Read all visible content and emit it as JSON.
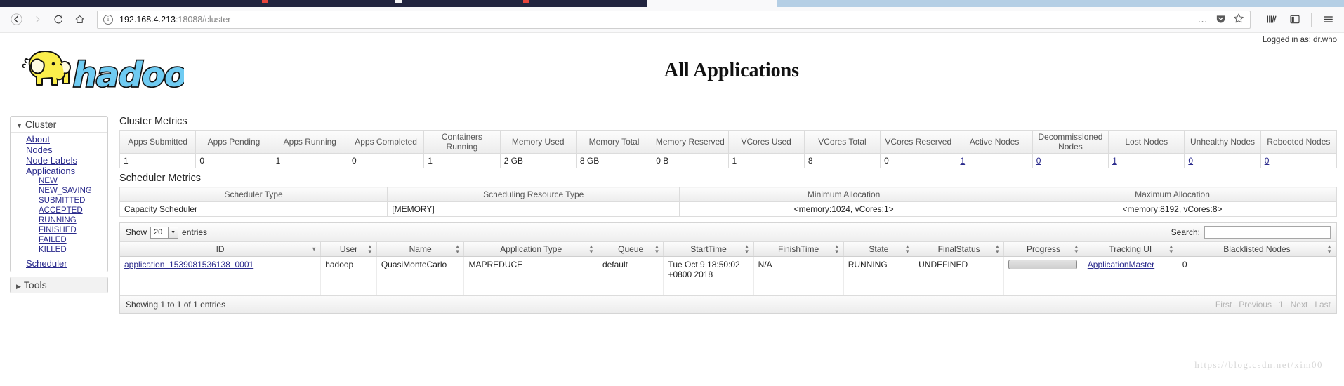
{
  "browser": {
    "back_icon": "back-arrow-icon",
    "forward_icon": "forward-arrow-icon",
    "reload_icon": "reload-icon",
    "home_icon": "home-icon",
    "url_host": "192.168.4.213",
    "url_rest": ":18088/cluster",
    "url_full": "192.168.4.213:18088/cluster",
    "page_actions_label": "…",
    "pocket_label": "▼",
    "star_label": "☆",
    "library_label": "|||\\",
    "sidebar_label": "▥",
    "menu_label": "☰"
  },
  "header": {
    "logged_in": "Logged in as: dr.who",
    "logo_text": "hadoop",
    "title": "All Applications"
  },
  "sidebar": {
    "cluster": {
      "label": "Cluster",
      "items": [
        {
          "label": "About"
        },
        {
          "label": "Nodes"
        },
        {
          "label": "Node Labels"
        },
        {
          "label": "Applications"
        }
      ],
      "app_states": [
        {
          "label": "NEW"
        },
        {
          "label": "NEW_SAVING"
        },
        {
          "label": "SUBMITTED"
        },
        {
          "label": "ACCEPTED"
        },
        {
          "label": "RUNNING"
        },
        {
          "label": "FINISHED"
        },
        {
          "label": "FAILED"
        },
        {
          "label": "KILLED"
        }
      ],
      "scheduler": {
        "label": "Scheduler"
      }
    },
    "tools": {
      "label": "Tools"
    }
  },
  "cluster_metrics": {
    "title": "Cluster Metrics",
    "columns": [
      "Apps Submitted",
      "Apps Pending",
      "Apps Running",
      "Apps Completed",
      "Containers Running",
      "Memory Used",
      "Memory Total",
      "Memory Reserved",
      "VCores Used",
      "VCores Total",
      "VCores Reserved",
      "Active Nodes",
      "Decommissioned Nodes",
      "Lost Nodes",
      "Unhealthy Nodes",
      "Rebooted Nodes"
    ],
    "values": [
      {
        "text": "1",
        "link": false
      },
      {
        "text": "0",
        "link": false
      },
      {
        "text": "1",
        "link": false
      },
      {
        "text": "0",
        "link": false
      },
      {
        "text": "1",
        "link": false
      },
      {
        "text": "2 GB",
        "link": false
      },
      {
        "text": "8 GB",
        "link": false
      },
      {
        "text": "0 B",
        "link": false
      },
      {
        "text": "1",
        "link": false
      },
      {
        "text": "8",
        "link": false
      },
      {
        "text": "0",
        "link": false
      },
      {
        "text": "1",
        "link": true
      },
      {
        "text": "0",
        "link": true
      },
      {
        "text": "1",
        "link": true
      },
      {
        "text": "0",
        "link": true
      },
      {
        "text": "0",
        "link": true
      }
    ]
  },
  "scheduler_metrics": {
    "title": "Scheduler Metrics",
    "columns": [
      "Scheduler Type",
      "Scheduling Resource Type",
      "Minimum Allocation",
      "Maximum Allocation"
    ],
    "row": {
      "scheduler_type": "Capacity Scheduler",
      "resource_type": "[MEMORY]",
      "min_allocation": "<memory:1024, vCores:1>",
      "max_allocation": "<memory:8192, vCores:8>"
    }
  },
  "apps_table": {
    "show_label": "Show",
    "entries_label": "entries",
    "page_size": "20",
    "search_label": "Search:",
    "search_value": "",
    "search_placeholder": "",
    "columns": [
      "ID",
      "User",
      "Name",
      "Application Type",
      "Queue",
      "StartTime",
      "FinishTime",
      "State",
      "FinalStatus",
      "Progress",
      "Tracking UI",
      "Blacklisted Nodes"
    ],
    "rows": [
      {
        "id": "application_1539081536138_0001",
        "user": "hadoop",
        "name": "QuasiMonteCarlo",
        "app_type": "MAPREDUCE",
        "queue": "default",
        "start_time": "Tue Oct 9 18:50:02 +0800 2018",
        "finish_time": "N/A",
        "state": "RUNNING",
        "final_status": "UNDEFINED",
        "progress": "0",
        "tracking_ui": "ApplicationMaster",
        "blacklisted_nodes": "0"
      }
    ],
    "info": "Showing 1 to 1 of 1 entries",
    "pager": {
      "first": "First",
      "previous": "Previous",
      "page": "1",
      "next": "Next",
      "last": "Last"
    }
  },
  "watermark": "https://blog.csdn.net/xim00"
}
